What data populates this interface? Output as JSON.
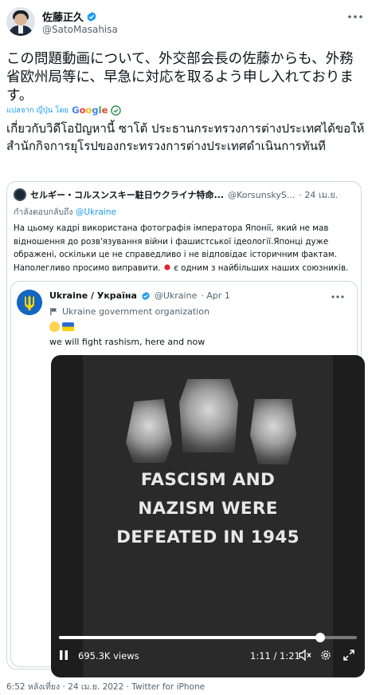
{
  "author": {
    "display_name": "佐藤正久",
    "handle": "@SatoMasahisa"
  },
  "tweet": {
    "text_original": "この問題動画について、外交部会長の佐藤からも、外務省欧州局等に、早急に対応を取るよう申し入れております。",
    "translate_label": "แปลจาก ญี่ปุ่น โดย",
    "translate_provider": "Google",
    "text_translated": "เกี่ยวกับวิดีโอปัญหานี้ ซาโต้ ประธานกระทรวงการต่างประเทศได้ขอให้สำนักกิจการยุโรปของกระทรวงการต่างประเทศดำเนินการทันที",
    "timestamp": "6:52 หลังเที่ยง · 24 เม.ย. 2022 · Twitter for iPhone"
  },
  "quoted": {
    "display_name": "セルギー・コルスンスキー駐日ウクライナ特命...",
    "handle": "@KorsunskyS...",
    "date": "· 24 เม.ย.",
    "reply_label": "กำลังตอบกลับถึง",
    "reply_to": "@Ukraine",
    "text_line1": "На цьому кадрі використана фотографія імператора Японії, який не мав",
    "text_line2": "відношення до розв'язування війни і фашистської ідеології.Японці дуже",
    "text_line3": "ображені, оскільки це не справедливо і не відповідає історичним фактам.",
    "text_line4_before_flag": "Наполегливо просимо виправити.",
    "text_line4_after_flag": "є одним з найбільших наших союзників."
  },
  "inner": {
    "display_name": "Ukraine / Україна",
    "handle": "@Ukraine",
    "date": "· Apr 1",
    "label": "Ukraine government organization",
    "text": "we will fight rashism, here and now",
    "video": {
      "line1": "FASCISM AND",
      "line2": "NAZISM WERE",
      "line3": "DEFEATED IN 1945",
      "views": "695.3K views",
      "time": "1:11 / 1:21",
      "progress_fraction": 0.877
    }
  },
  "colors": {
    "accent": "#1d9bf0",
    "text": "#0f1419",
    "muted": "#536471",
    "border": "#cfd9de"
  },
  "icons": [
    "verified-badge-icon",
    "more-icon",
    "google-check-icon",
    "ukraine-trident-icon",
    "gov-flag-icon",
    "pause-icon",
    "mute-icon",
    "settings-icon",
    "fullscreen-icon",
    "japan-flag-icon"
  ]
}
